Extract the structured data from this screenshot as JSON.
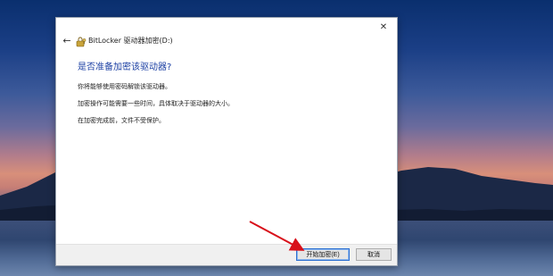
{
  "window": {
    "title": "BitLocker 驱动器加密(D:)",
    "close_glyph": "✕",
    "back_glyph": "←"
  },
  "content": {
    "heading": "是否准备加密该驱动器?",
    "para1": "你将能够使用密码解锁该驱动器。",
    "para2": "加密操作可能需要一些时间，具体取决于驱动器的大小。",
    "para3": "在加密完成前，文件不受保护。"
  },
  "buttons": {
    "start": "开始加密(E)",
    "cancel": "取消"
  },
  "colors": {
    "accent_heading": "#1b3fa3",
    "annotation_arrow": "#d8101a",
    "focus_border": "#2c6fd1"
  },
  "icons": {
    "bitlocker": "bitlocker-key-icon",
    "back": "back-arrow-icon",
    "close": "close-icon"
  }
}
